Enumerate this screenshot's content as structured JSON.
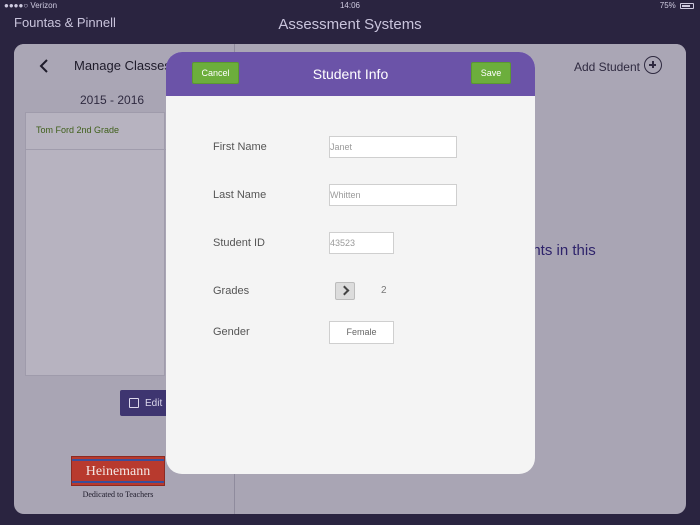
{
  "status_bar": {
    "carrier": "●●●●○ Verizon",
    "time": "14:06",
    "battery": "75%"
  },
  "app": {
    "brand": "Fountas & Pinnell",
    "title": "Assessment Systems"
  },
  "background": {
    "header_title": "Manage Classes",
    "add_student_label": "Add Student",
    "year": "2015 - 2016",
    "classes": [
      {
        "name": "Tom Ford 2nd Grade"
      }
    ],
    "edit_label": "Edit",
    "message_fragment": "ents in this",
    "logo": {
      "name": "Heinemann",
      "tagline": "Dedicated to Teachers"
    }
  },
  "modal": {
    "title": "Student Info",
    "cancel_label": "Cancel",
    "save_label": "Save",
    "fields": {
      "first_name": {
        "label": "First Name",
        "value": "Janet"
      },
      "last_name": {
        "label": "Last Name",
        "value": "Whitten"
      },
      "student_id": {
        "label": "Student ID",
        "value": "43523"
      },
      "grades": {
        "label": "Grades",
        "value": "2"
      },
      "gender": {
        "label": "Gender",
        "value": "Female"
      }
    }
  },
  "colors": {
    "modal_header": "#6b53a8",
    "button_green": "#6cae3c",
    "background_dim": "#a9a5b4"
  }
}
